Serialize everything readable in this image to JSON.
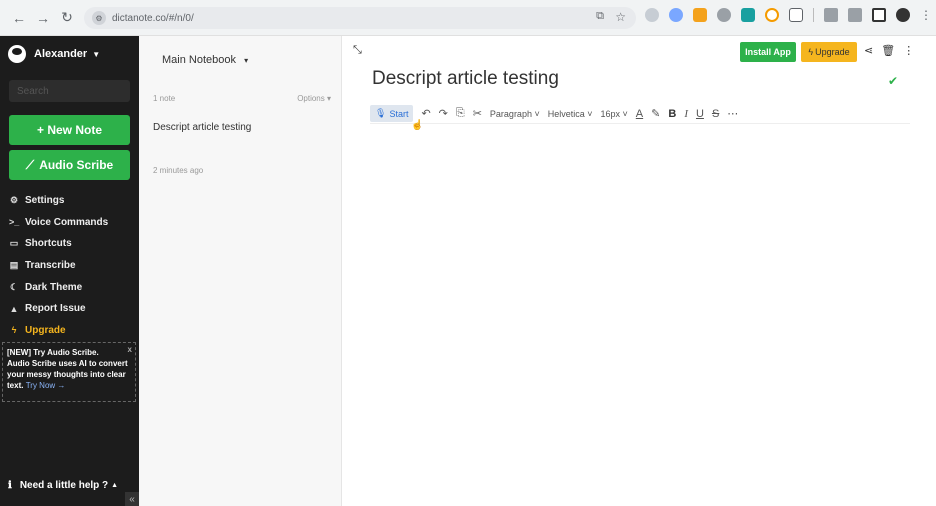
{
  "browser": {
    "url": "dictanote.co/#/n/0/",
    "back": "←",
    "forward": "→",
    "reload": "↻",
    "star": "☆",
    "cast": "⧉"
  },
  "sidebar": {
    "user": "Alexander",
    "search_placeholder": "Search",
    "new_note": "+ New Note",
    "audio_scribe": "Audio Scribe",
    "menu": [
      {
        "label": "Settings",
        "icon": "gear-icon",
        "glyph": "⚙"
      },
      {
        "label": "Voice Commands",
        "icon": "terminal-icon",
        "glyph": ">_"
      },
      {
        "label": "Shortcuts",
        "icon": "keyboard-icon",
        "glyph": "▭"
      },
      {
        "label": "Transcribe",
        "icon": "file-icon",
        "glyph": "▤"
      },
      {
        "label": "Dark Theme",
        "icon": "moon-icon",
        "glyph": "☾"
      },
      {
        "label": "Report Issue",
        "icon": "warning-icon",
        "glyph": "▲"
      },
      {
        "label": "Upgrade",
        "icon": "bolt-icon",
        "glyph": "ϟ"
      }
    ],
    "promo": {
      "heading": "[NEW] Try Audio Scribe.",
      "body": "Audio Scribe uses AI to convert your messy thoughts into clear text.",
      "cta": "Try Now →",
      "close": "x"
    },
    "help": "Need a little help ?",
    "collapse": "«"
  },
  "notes": {
    "notebook": "Main Notebook",
    "count": "1 note",
    "options": "Options ▾",
    "items": [
      {
        "title": "Descript article testing",
        "time": "2 minutes ago"
      }
    ]
  },
  "editor": {
    "install_app": "Install App",
    "upgrade": "Upgrade",
    "title": "Descript article testing",
    "toolbar": {
      "start": "Start",
      "paragraph": "Paragraph",
      "font": "Helvetica",
      "size": "16px"
    }
  }
}
